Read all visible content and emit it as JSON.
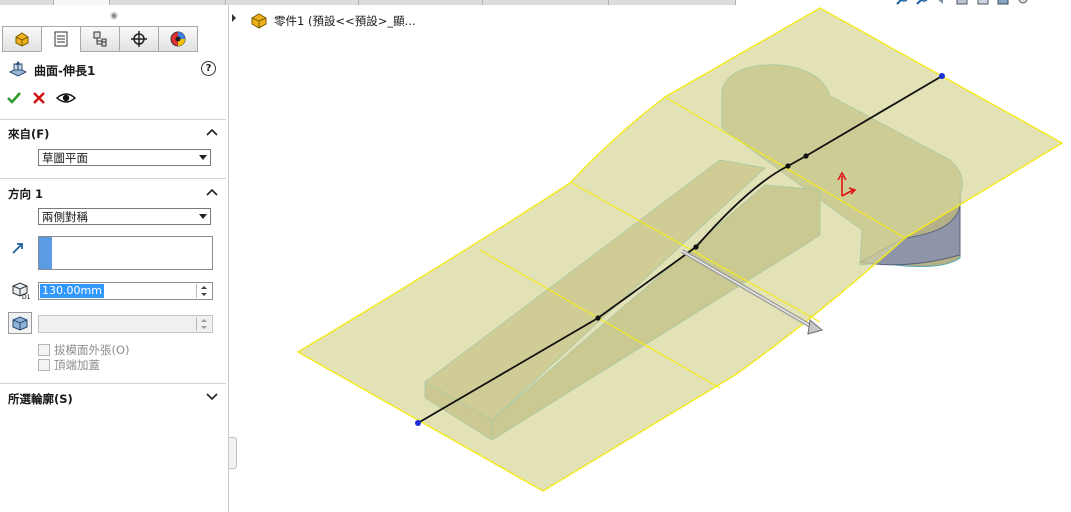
{
  "panel": {
    "feature_title": "曲面-伸長1",
    "help_glyph": "?",
    "from_group": {
      "title": "來自(F)",
      "selected": "草圖平面"
    },
    "direction1_group": {
      "title": "方向 1",
      "end_condition": "兩側對稱",
      "depth_value": "130.00mm",
      "draft_value": "",
      "draft_outward_label": "拔模面外張(O)",
      "cap_end_label": "頂端加蓋"
    },
    "contours_group": {
      "title": "所選輪廓(S)"
    }
  },
  "tree": {
    "part_label": "零件1  (預設<<預設>_顯..."
  },
  "colors": {
    "surface_fill": "#d8d79a",
    "surface_edge": "#f2ea1c",
    "solid_wall": "#b5b283",
    "ok_green": "#2e9b2e",
    "cancel_red": "#d01010",
    "selection_blue": "#3399ff"
  },
  "icons": {
    "tabs": [
      "feature-manager-icon",
      "property-manager-icon",
      "configuration-manager-icon",
      "dimxpert-icon",
      "appearance-icon"
    ],
    "ok": "checkmark-icon",
    "cancel": "x-icon",
    "preview": "eye-icon"
  }
}
